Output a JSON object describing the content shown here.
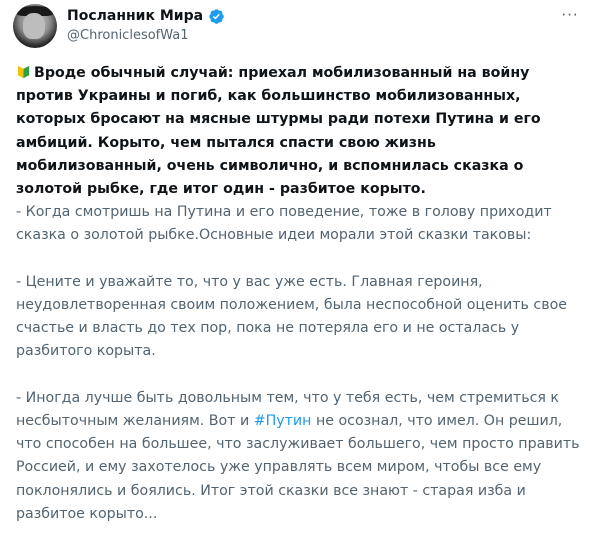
{
  "author": {
    "display_name": "Посланник Мира",
    "handle": "@ChroniclesofWa1",
    "verified": true,
    "avatar_icon": "avatar-portrait"
  },
  "actions": {
    "more_label": "···"
  },
  "post": {
    "lead_icon": "beginner-leaf-icon",
    "lead_text": "Вроде обычный случай: приехал мобилизованный на войну против Украины и погиб, как большинство мобилизованных, которых бросают на мясные штурмы ради потехи Путина и его амбиций. Корыто, чем пытался спасти свою жизнь мобилизованный, очень символично, и вспомнилась сказка о золотой рыбке, где итог один - разбитое корыто.",
    "p1": "- Когда смотришь на Путина и его поведение, тоже в голову приходит сказка о золотой рыбке.Основные идеи морали этой сказки таковы:",
    "p2": "- Цените и уважайте то, что у вас уже есть. Главная героиня, неудовлетворенная своим положением, была неспособной оценить свое счастье и власть до тех пор, пока не потеряла его и не осталась у разбитого корыта.",
    "p3_before": "- Иногда лучше быть довольным тем, что у тебя есть, чем стремиться к несбыточным желаниям. Вот и ",
    "p3_hashtag": "#Путин",
    "p3_after": " не осознал, что имел. Он решил, что способен на большее, что заслуживает большего, чем просто править Россией, и ему захотелось уже управлять всем миром, чтобы все ему поклонялись и боялись. Итог этой сказки все знают - старая изба и разбитое корыто..."
  },
  "colors": {
    "text": "#0f1419",
    "secondary": "#536471",
    "link": "#1d9bf0",
    "verified": "#1d9bf0"
  }
}
